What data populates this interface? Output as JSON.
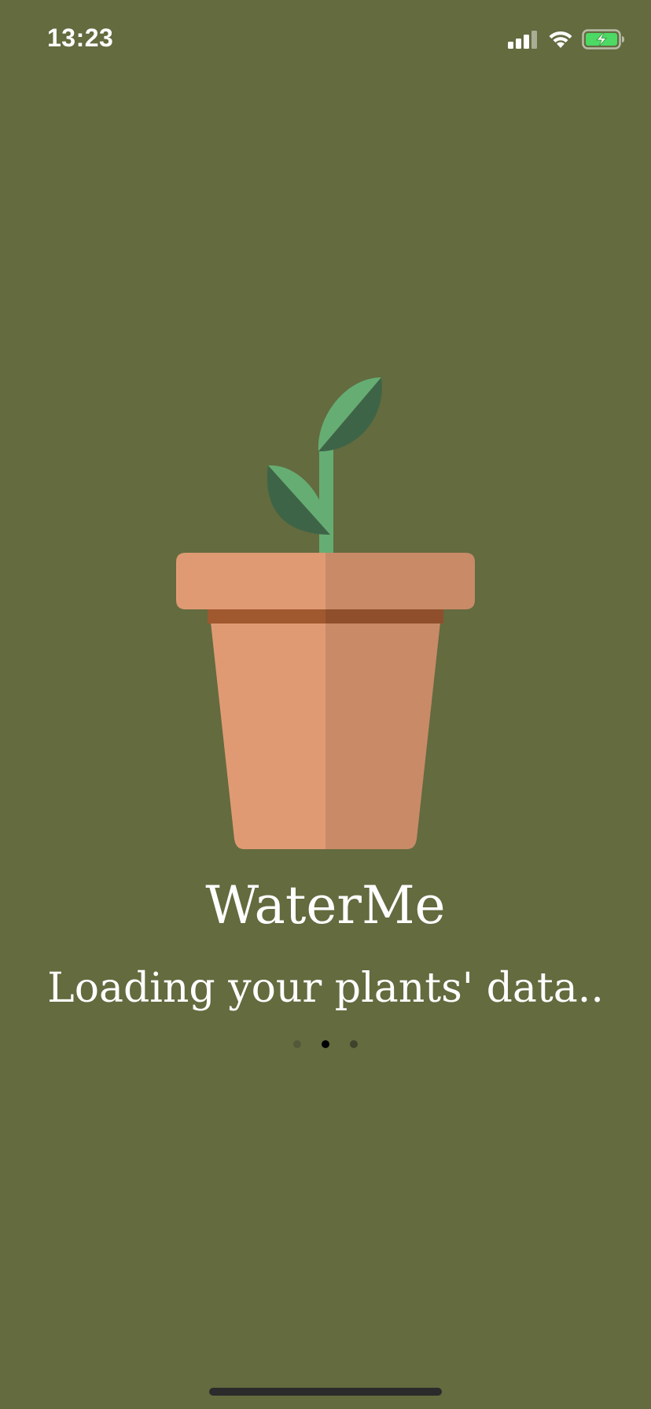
{
  "status_bar": {
    "time": "13:23",
    "icons": [
      "signal-icon",
      "wifi-icon",
      "battery-charging-icon"
    ],
    "battery_color": "#4cd964"
  },
  "app": {
    "title": "WaterMe",
    "loading_message": "Loading your plants' data..",
    "illustration": "potted-plant-icon"
  },
  "loading_indicator": {
    "dots": 3,
    "active_index": 1
  },
  "colors": {
    "background": "#636b3f",
    "pot_light": "#e09a73",
    "pot_shadow": "#c98a68",
    "pot_band": "#a0582f",
    "leaf_light": "#66ad73",
    "leaf_dark": "#3e6447"
  }
}
